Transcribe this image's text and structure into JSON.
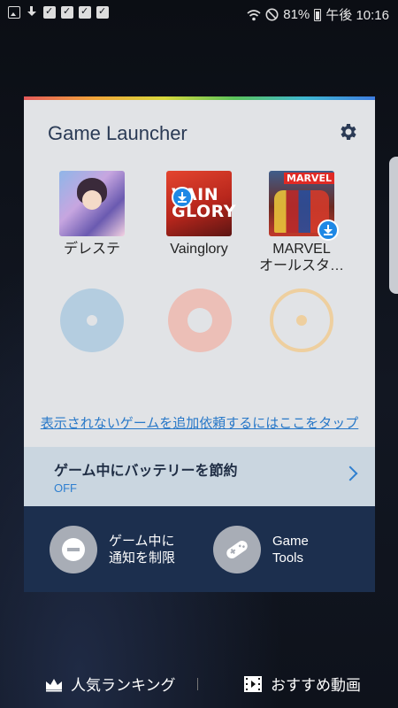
{
  "status_bar": {
    "left_icons": [
      "image-icon",
      "download-icon",
      "bag-check-icon",
      "bag-check-icon",
      "bag-check-icon",
      "bag-check-icon"
    ],
    "right_icons": [
      "wifi-icon",
      "do-not-disturb-icon",
      "battery-icon"
    ],
    "battery": "81%",
    "time": "午後 10:16"
  },
  "launcher": {
    "title": "Game Launcher",
    "games": [
      {
        "name": "デレステ"
      },
      {
        "name": "Vainglory",
        "tile_text": "VAIN\nGLORY",
        "badge": "download-icon"
      },
      {
        "name": "MARVEL\nオールスタ…",
        "tile_text": "MARVEL",
        "badge": "download-icon"
      }
    ],
    "request_link": "表示されないゲームを追加依頼するにはここをタップ",
    "battery_saver": {
      "label": "ゲーム中にバッテリーを節約",
      "status": "OFF"
    },
    "tools": [
      {
        "label": "ゲーム中に\n通知を制限",
        "icon": "minus-circle-icon"
      },
      {
        "label": "Game\nTools",
        "icon": "gamepad-icon"
      }
    ]
  },
  "bottom_bar": {
    "ranking": "人気ランキング",
    "videos": "おすすめ動画"
  },
  "colors": {
    "accent": "#2878c8",
    "card_bg": "#e1e3e6",
    "dark_section": "#1c2f4e",
    "battery_row": "#cad6e0"
  }
}
